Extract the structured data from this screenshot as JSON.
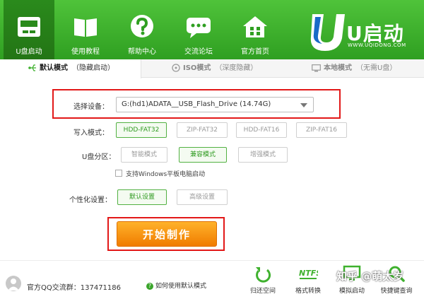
{
  "nav": {
    "items": [
      {
        "label": "U盘启动",
        "icon": "usb-drive-icon"
      },
      {
        "label": "使用教程",
        "icon": "book-icon"
      },
      {
        "label": "帮助中心",
        "icon": "help-icon"
      },
      {
        "label": "交流论坛",
        "icon": "chat-icon"
      },
      {
        "label": "官方首页",
        "icon": "home-icon"
      }
    ],
    "logo_text": "U启动",
    "logo_url": "WWW.UQIDONG.COM"
  },
  "tabs": [
    {
      "mode": "默认模式",
      "note": "（隐藏启动）"
    },
    {
      "mode": "ISO模式",
      "note": "（深度隐藏）"
    },
    {
      "mode": "本地模式",
      "note": "（无需U盘）"
    }
  ],
  "device": {
    "label": "选择设备：",
    "value": "G:(hd1)ADATA__USB_Flash_Drive (14.74G)"
  },
  "write_mode": {
    "label": "写入模式：",
    "options": [
      "HDD-FAT32",
      "ZIP-FAT32",
      "HDD-FAT16",
      "ZIP-FAT16"
    ],
    "selected": "HDD-FAT32"
  },
  "partition": {
    "label": "U盘分区：",
    "options": [
      "智能模式",
      "兼容模式",
      "增强模式"
    ],
    "selected": "兼容模式"
  },
  "tablet_checkbox": {
    "label": "支持Windows平板电脑启动",
    "checked": false
  },
  "personalize": {
    "label": "个性化设置：",
    "options": [
      "默认设置",
      "高级设置"
    ],
    "selected": "默认设置"
  },
  "start_button": "开始制作",
  "footer": {
    "qq_group": "官方QQ交流群：137471186",
    "help_link": "如何使用默认模式",
    "tools": [
      {
        "label": "归还空间",
        "icon": "restore-icon"
      },
      {
        "label": "格式转换",
        "icon": "ntfs-icon"
      },
      {
        "label": "模拟启动",
        "icon": "monitor-icon"
      },
      {
        "label": "快捷键查询",
        "icon": "search-icon"
      }
    ],
    "watermark": "知乎 @萌太岁"
  },
  "colors": {
    "brand_green": "#3fb12e",
    "accent_orange": "#f39a12",
    "highlight_red": "#e21818"
  }
}
